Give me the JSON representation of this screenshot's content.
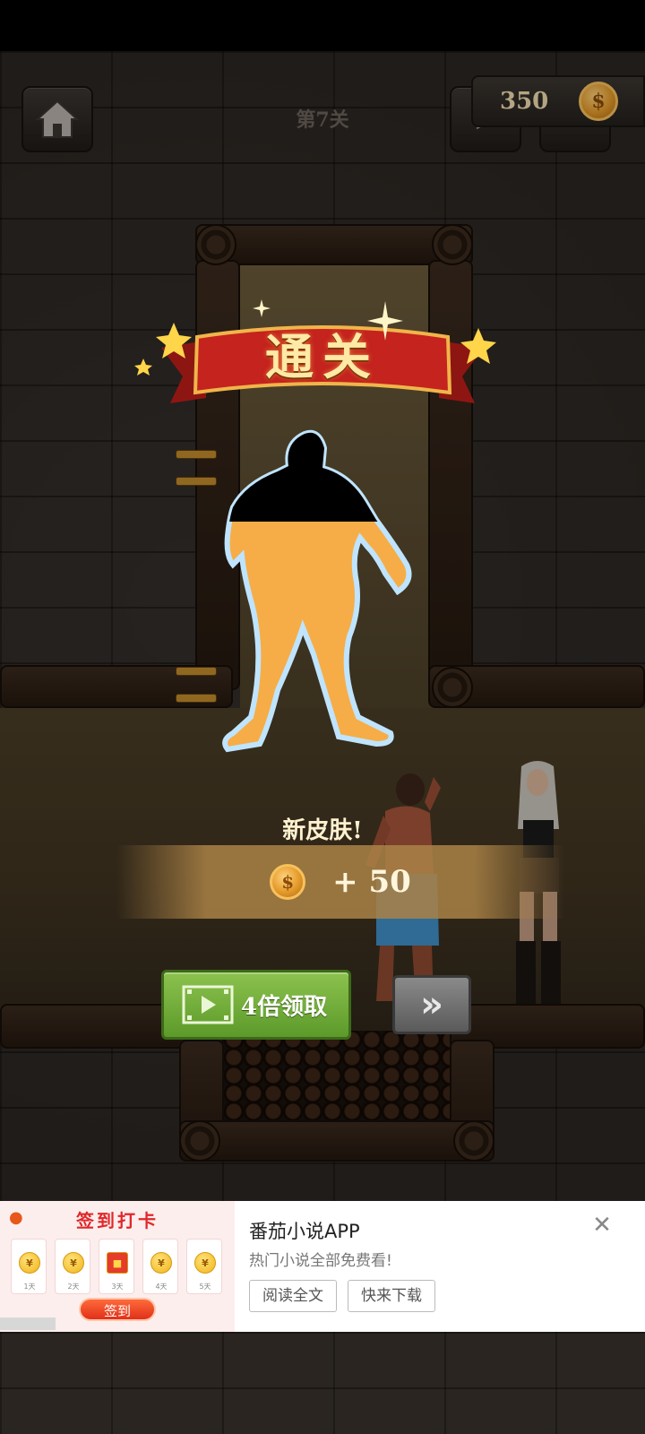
{
  "hud": {
    "level_title": "第7关",
    "coins": "350",
    "home_icon": "home-icon",
    "coin_icon": "coin-icon"
  },
  "result": {
    "banner_text": "通关",
    "new_skin_text": "新皮肤!",
    "reward_text": "+ 50",
    "skin_unlock_progress": 0.55,
    "colors": {
      "skin_fill": "#f6ad47",
      "skin_outline": "#bfe4ff",
      "ribbon": "#c4231e"
    }
  },
  "actions": {
    "claim_label": "4倍领取",
    "video_icon": "video-play-icon",
    "skip_icon": "fast-forward-icon"
  },
  "ad": {
    "checkin_title": "签到打卡",
    "days": [
      "1天",
      "2天",
      "3天",
      "4天",
      "5天"
    ],
    "checkin_button": "签到",
    "title": "番茄小说APP",
    "subtitle": "热门小说全部免费看!",
    "btn_read": "阅读全文",
    "btn_download": "快来下载",
    "close_icon": "close-icon"
  }
}
